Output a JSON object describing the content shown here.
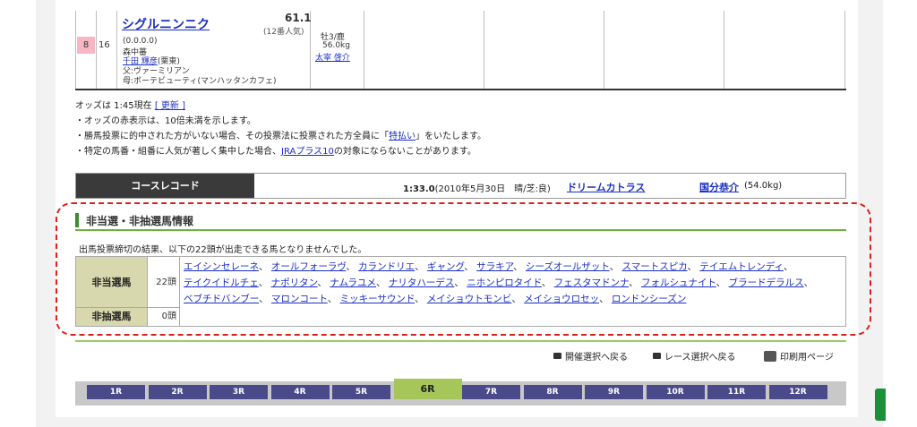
{
  "horse": {
    "waku": "8",
    "umaban": "16",
    "name": "シグルニンニク",
    "odds": "61.1",
    "popularity": "(12番人気)",
    "record": "(0.0.0.0)",
    "owner": "森中蕃",
    "trainer_link": "千田 輝彦",
    "trainer_stable": "(栗東)",
    "sire": "父:ヴァーミリアン",
    "dam": "母:ボーテビューティ(マンハッタンカフェ)",
    "sex_age": "牡3/鹿",
    "weight": "56.0kg",
    "jockey": "太宰 啓介"
  },
  "notes": {
    "odds_time": "オッズは 1:45現在",
    "refresh_link": "[ 更新 ]",
    "line1": "・オッズの赤表示は、10倍未満を示します。",
    "line2_pre": "・勝馬投票に的中された方がいない場合、その投票法に投票された方全員に「",
    "line2_link": "特払い",
    "line2_post": "」をいたします。",
    "line3_pre": "・特定の馬番・組番に人気が著しく集中した場合、",
    "line3_link": "JRAプラス10",
    "line3_post": "の対象にならないことがあります。"
  },
  "course_record": {
    "label": "コースレコード",
    "time": "1:33.0",
    "detail": "(2010年5月30日　晴/芝:良)",
    "horse": "ドリームカトラス",
    "jockey": "国分恭介",
    "jockey_weight": "(54.0kg)"
  },
  "excluded": {
    "title": "非当選・非抽選馬情報",
    "description": "出馬投票締切の結果、以下の22頭が出走できる馬となりませんでした。",
    "not_selected_label": "非当選馬",
    "not_selected_count": "22頭",
    "not_selected_horses": [
      "エイシンセレーネ",
      "オールフォーラヴ",
      "カランドリエ",
      "ギャング",
      "サラキア",
      "シーズオールザット",
      "スマートスピカ",
      "テイエムトレンディ",
      "テイクイドルチェ",
      "ナポリタン",
      "ナムラユメ",
      "ナリタハーデス",
      "ニホンピロタイド",
      "フェスタマドンナ",
      "フォルシュナイト",
      "ブラードデラルス",
      "ベブチドバンブー",
      "マロンコート",
      "ミッキーサウンド",
      "メイショウトモンビ",
      "メイショウロセッ",
      "ロンドンシーズン"
    ],
    "not_lottery_label": "非抽選馬",
    "not_lottery_count": "0頭"
  },
  "nav_links": {
    "back_meeting": "開催選択へ戻る",
    "back_race": "レース選択へ戻る",
    "print": "印刷用ページ"
  },
  "races": [
    "1R",
    "2R",
    "3R",
    "4R",
    "5R",
    "6R",
    "7R",
    "8R",
    "9R",
    "10R",
    "11R",
    "12R"
  ],
  "active_race": "6R",
  "colors": {
    "link": "#1a2fc4",
    "waku8": "#f7b6c4",
    "dash_border": "#e0201a",
    "header_cell": "#d7d8ad",
    "race_tab": "#4a4a8a",
    "race_tab_active": "#a6c65a"
  }
}
